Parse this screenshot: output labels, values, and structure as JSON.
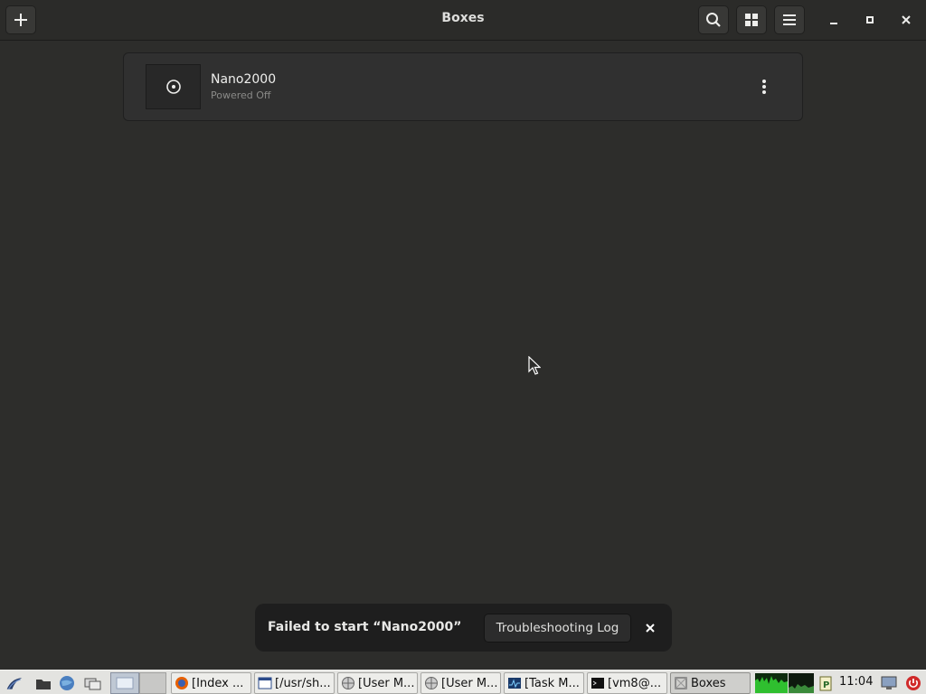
{
  "header": {
    "title": "Boxes"
  },
  "boxes": [
    {
      "name": "Nano2000",
      "status": "Powered Off"
    }
  ],
  "toast": {
    "message": "Failed to start “Nano2000”",
    "action_label": "Troubleshooting Log"
  },
  "taskbar": {
    "tasks": [
      {
        "label": "[Index ...",
        "icon": "firefox-icon"
      },
      {
        "label": "[/usr/sh...",
        "icon": "window-icon"
      },
      {
        "label": "[User M...",
        "icon": "web-icon"
      },
      {
        "label": "[User M...",
        "icon": "web-icon"
      },
      {
        "label": "[Task M...",
        "icon": "task-manager-icon"
      },
      {
        "label": "[vm8@...",
        "icon": "terminal-icon"
      },
      {
        "label": "Boxes",
        "icon": "boxes-icon"
      }
    ],
    "clock": "11:04"
  },
  "colors": {
    "background": "#2d2d2b",
    "toast": "#1e1e1e",
    "taskbar": "#e3e3e0"
  }
}
